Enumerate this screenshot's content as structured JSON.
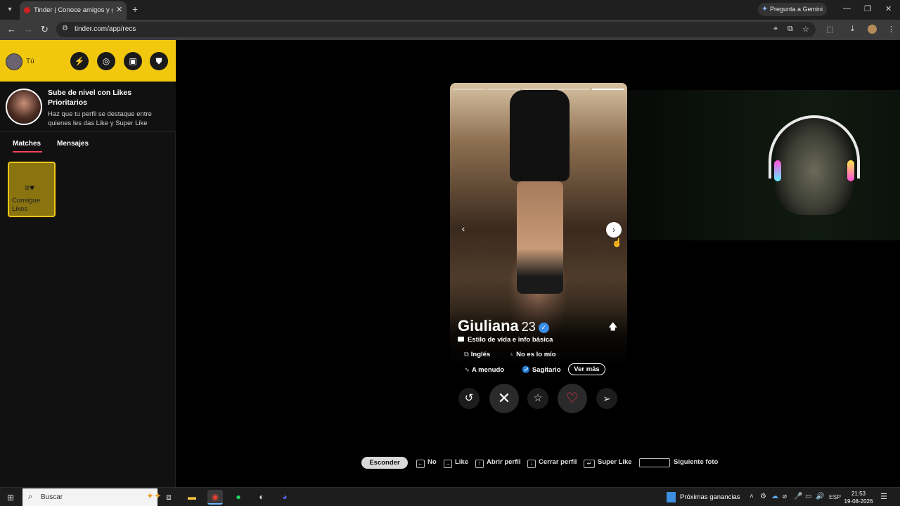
{
  "browser": {
    "tab_title": "Tinder | Conoce amigos y gente",
    "url": "tinder.com/app/recs",
    "gemini_label": "Pregunta a Gemini"
  },
  "sidebar": {
    "me_label": "Tú",
    "header_icons": [
      "boost-icon",
      "explore-icon",
      "briefcase-icon",
      "shield-icon"
    ],
    "promo_title": "Sube de nivel con Likes Prioritarios",
    "promo_text": "Haz que tu perfil se destaque entre quienes les das Like y Super Like",
    "tabs": [
      {
        "label": "Matches"
      },
      {
        "label": "Mensajes"
      }
    ],
    "likes_card_label": "Consigue Likes"
  },
  "profile": {
    "name": "Giuliana",
    "age": "23",
    "photo_count": 5,
    "current_photo": 5,
    "info_line": "Estilo de vida e info básica",
    "chips": [
      {
        "icon": "🗚",
        "label": "Inglés"
      },
      {
        "icon": "🍷",
        "label": "No es lo mío"
      },
      {
        "icon": "✎",
        "label": "A menudo"
      },
      {
        "icon": "♐",
        "label": "Sagitario"
      }
    ],
    "more_button": "Ver más"
  },
  "shortcuts": {
    "hide": "Esconder",
    "no": "No",
    "like": "Like",
    "open_profile": "Abrir perfil",
    "close_profile": "Cerrar perfil",
    "super_like": "Super Like",
    "next_photo": "Siguiente foto"
  },
  "taskbar": {
    "search_placeholder": "Buscar",
    "news": "Próximas ganancias",
    "lang": "ESP",
    "time": "21:53",
    "date": "19-08-2026"
  },
  "colors": {
    "brand_yellow": "#f2c80f",
    "like_red": "#ff3b55",
    "verified_blue": "#3a8de8"
  }
}
